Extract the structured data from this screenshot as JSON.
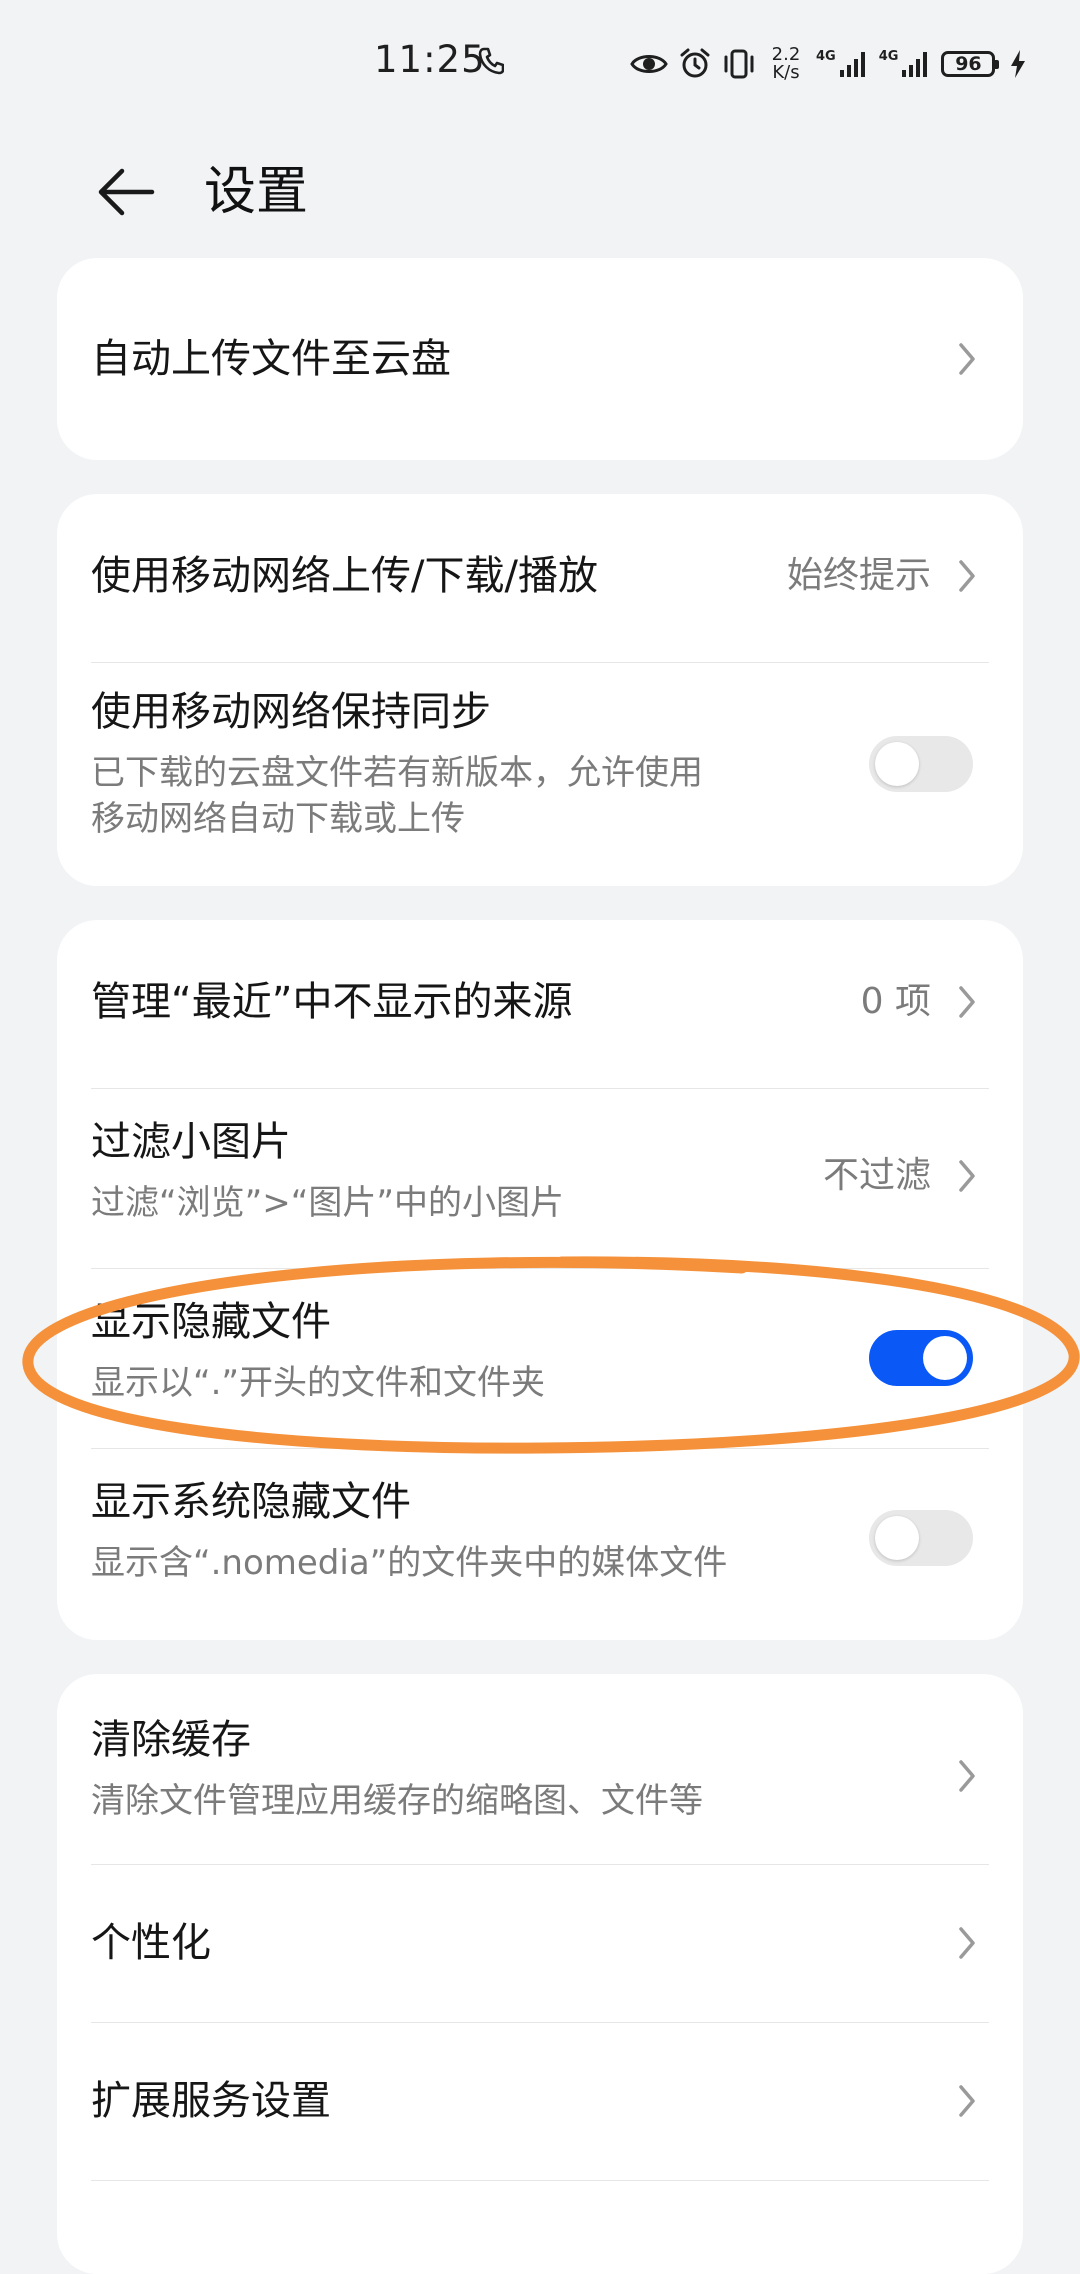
{
  "status_bar": {
    "time": "11:25",
    "net_speed_value": "2.2",
    "net_speed_unit": "K/s",
    "sim1_label": "4G",
    "sim2_label": "4G",
    "battery": "96"
  },
  "header": {
    "title": "设置"
  },
  "cards": [
    {
      "rows": [
        {
          "title": "自动上传文件至云盘",
          "control": "chevron"
        }
      ]
    },
    {
      "rows": [
        {
          "title": "使用移动网络上传/下载/播放",
          "value": "始终提示",
          "control": "chevron"
        },
        {
          "title": "使用移动网络保持同步",
          "subtitle_line1": "已下载的云盘文件若有新版本，允许使用",
          "subtitle_line2": "移动网络自动下载或上传",
          "control": "toggle",
          "toggle_state": "off"
        }
      ]
    },
    {
      "rows": [
        {
          "title": "管理“最近”中不显示的来源",
          "value": "0 项",
          "control": "chevron"
        },
        {
          "title": "过滤小图片",
          "subtitle": "过滤“浏览”>“图片”中的小图片",
          "value": "不过滤",
          "control": "chevron"
        },
        {
          "title": "显示隐藏文件",
          "subtitle": "显示以“.”开头的文件和文件夹",
          "control": "toggle",
          "toggle_state": "on"
        },
        {
          "title": "显示系统隐藏文件",
          "subtitle": "显示含“.nomedia”的文件夹中的媒体文件",
          "control": "toggle",
          "toggle_state": "off"
        }
      ]
    },
    {
      "rows": [
        {
          "title": "清除缓存",
          "subtitle": "清除文件管理应用缓存的缩略图、文件等",
          "control": "chevron"
        },
        {
          "title": "个性化",
          "control": "chevron"
        },
        {
          "title": "扩展服务设置",
          "control": "chevron"
        }
      ]
    }
  ],
  "colors": {
    "background": "#f1f3f5",
    "card": "#ffffff",
    "accent": "#0a59f7",
    "annotation": "#f5913a",
    "secondary_text": "#7b7b7b"
  }
}
